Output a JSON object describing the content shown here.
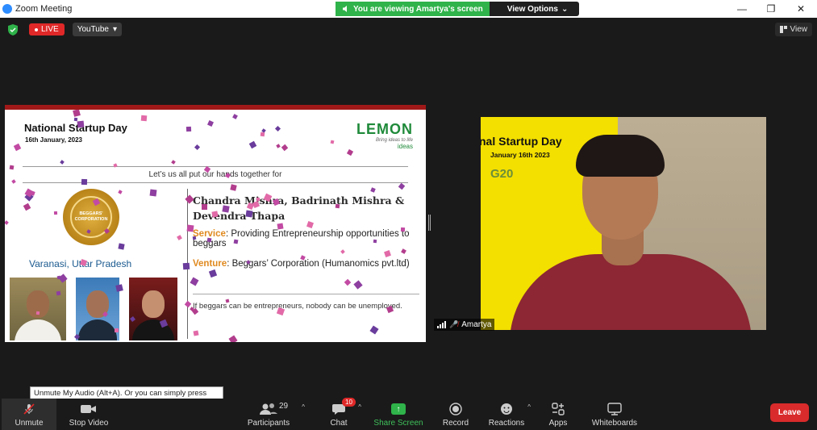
{
  "window": {
    "title": "Zoom Meeting"
  },
  "banner": {
    "viewing": "You are viewing Amartya's screen",
    "options": "View Options"
  },
  "topbar": {
    "live": "LIVE",
    "platform": "YouTube",
    "view": "View"
  },
  "slide": {
    "title": "National Startup Day",
    "date": "16th January, 2023",
    "logo_text": "LEMON",
    "logo_tagline": "Bring ideas to life",
    "logo_ideas": "ideas",
    "subtitle": "Let’s us all put our hands together for",
    "badge": "BEGGARS' CORPORATION",
    "city": "Varanasi, Uttar Pradesh",
    "names": "Chandra Mishra, Badrinath Mishra & Devendra Thapa",
    "service_label": "Service",
    "service_text": ": Providing Entrepreneurship opportunities to beggars",
    "venture_label": "Venture",
    "venture_text": ": Beggars’ Corporation (Humanomics pvt.ltd)",
    "quote": "If beggars can be entrepreneurs, nobody can be unemployed."
  },
  "video": {
    "backdrop_title": "nal Startup Day",
    "backdrop_date": "January 16th 2023",
    "backdrop_g20": "G20",
    "participant": "Amartya"
  },
  "tooltip": "Unmute My Audio (Alt+A). Or you can simply press and hold the space bar to temporarily unmute.",
  "toolbar": {
    "unmute": "Unmute",
    "stop_video": "Stop Video",
    "participants": "Participants",
    "participants_count": "29",
    "chat": "Chat",
    "chat_badge": "10",
    "share_screen": "Share Screen",
    "record": "Record",
    "reactions": "Reactions",
    "apps": "Apps",
    "whiteboards": "Whiteboards",
    "leave": "Leave"
  },
  "colors": {
    "live": "#e02828",
    "share": "#2fb34a",
    "leave": "#d92b2b",
    "slide_accent": "#e08a20"
  }
}
